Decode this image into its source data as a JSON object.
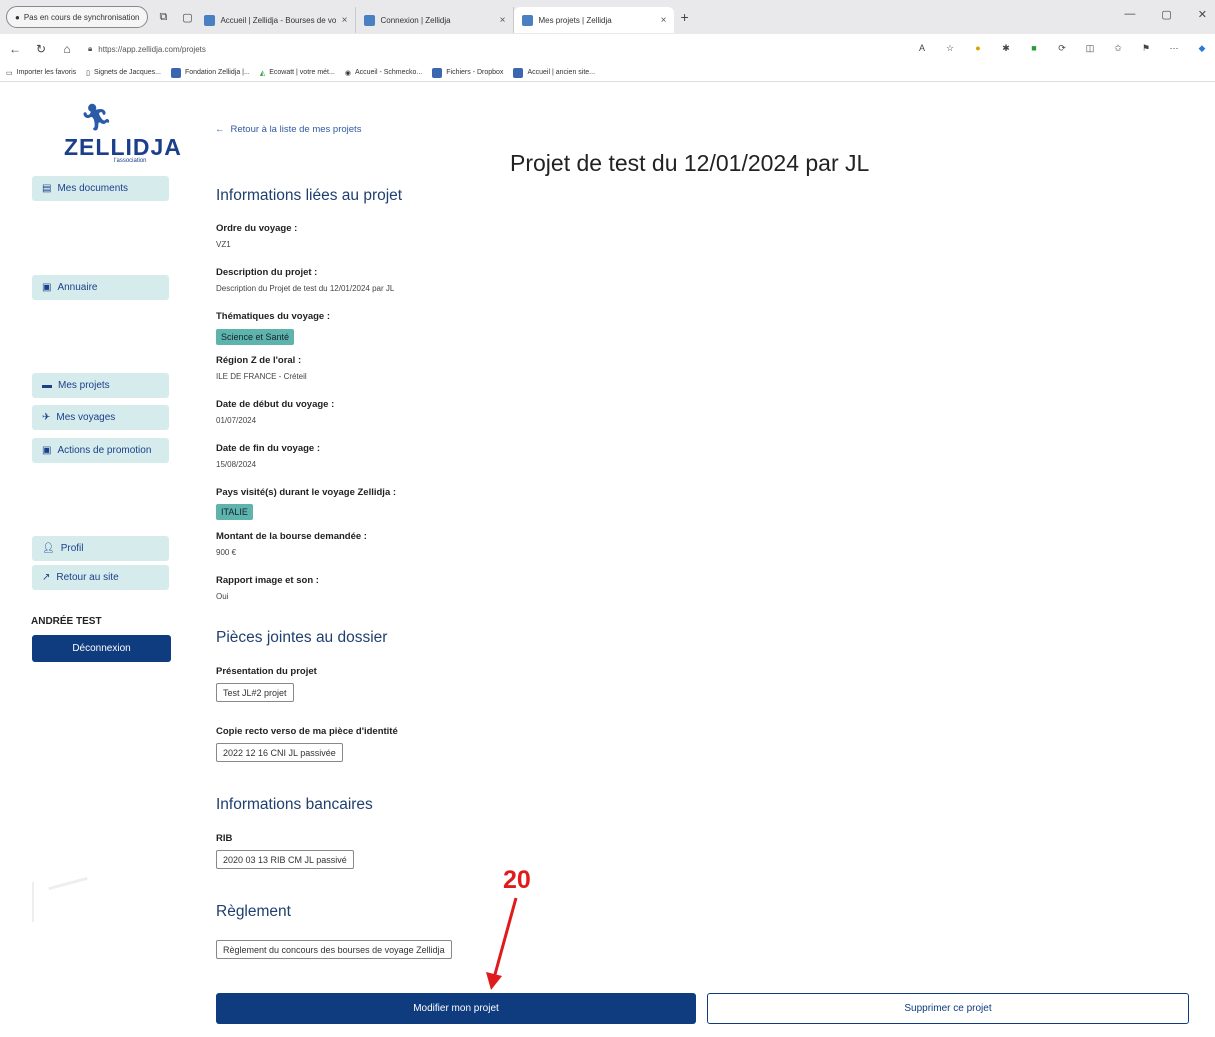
{
  "browser": {
    "sync_label": "Pas en cours de synchronisation",
    "tabs": [
      {
        "label": "Accueil | Zellidja - Bourses de vo",
        "active": false
      },
      {
        "label": "Connexion | Zellidja",
        "active": false
      },
      {
        "label": "Mes projets | Zellidja",
        "active": true
      }
    ],
    "new_tab": "+",
    "url": "https://app.zellidja.com/projets",
    "bookmarks": [
      "Importer les favoris",
      "Signets de Jacques...",
      "Fondation Zellidja |...",
      "Ecowatt | votre mét...",
      "Accueil - Schmecko...",
      "Fichiers - Dropbox",
      "Accueil | ancien site..."
    ]
  },
  "sidebar": {
    "logo_text": "ZELLIDJA",
    "logo_sub": "l'association",
    "items": [
      {
        "label": "Mes documents",
        "icon": "documents-icon"
      },
      {
        "label": "Annuaire",
        "icon": "book-icon"
      },
      {
        "label": "Mes projets",
        "icon": "folder-icon"
      },
      {
        "label": "Mes voyages",
        "icon": "plane-icon"
      },
      {
        "label": "Actions de promotion",
        "icon": "megaphone-icon"
      },
      {
        "label": "Profil",
        "icon": "user-icon"
      },
      {
        "label": "Retour au site",
        "icon": "external-link-icon"
      }
    ],
    "user_name": "ANDRÉE TEST",
    "logout_label": "Déconnexion"
  },
  "main": {
    "back_link": "Retour à la liste de mes projets",
    "title": "Projet de test du 12/01/2024 par JL",
    "section_info": "Informations liées au projet",
    "fields": {
      "ordre_label": "Ordre du voyage :",
      "ordre_value": "VZ1",
      "desc_label": "Description du projet :",
      "desc_value": "Description du Projet de test du 12/01/2024 par JL",
      "themes_label": "Thématiques du voyage :",
      "themes_tag": "Science et Santé",
      "region_label": "Région Z de l'oral :",
      "region_value": "ILE DE FRANCE - Créteil",
      "start_label": "Date de début du voyage :",
      "start_value": "01/07/2024",
      "end_label": "Date de fin du voyage :",
      "end_value": "15/08/2024",
      "countries_label": "Pays visité(s) durant le voyage Zellidja :",
      "countries_tag": "ITALIE",
      "amount_label": "Montant de la bourse demandée :",
      "amount_value": "900 €",
      "report_label": "Rapport image et son :",
      "report_value": "Oui"
    },
    "section_attachments": "Pièces jointes au dossier",
    "attachments": {
      "presentation_label": "Présentation du projet",
      "presentation_file": "Test JL#2 projet",
      "id_label": "Copie recto verso de ma pièce d'identité",
      "id_file": "2022 12 16 CNI JL passivée"
    },
    "section_bank": "Informations bancaires",
    "bank": {
      "rib_label": "RIB",
      "rib_file": "2020 03 13 RIB CM JL passivé"
    },
    "section_rules": "Règlement",
    "rules_file": "Règlement du concours des bourses de voyage Zellidja",
    "edit_button": "Modifier mon projet",
    "delete_button": "Supprimer ce projet"
  },
  "annotation": {
    "number": "20",
    "color": "#e01b1b"
  },
  "colors": {
    "brand_dark": "#0f3b7f",
    "sidebar_button_bg": "#d6ecec",
    "tag_bg": "#5fb3ad"
  }
}
